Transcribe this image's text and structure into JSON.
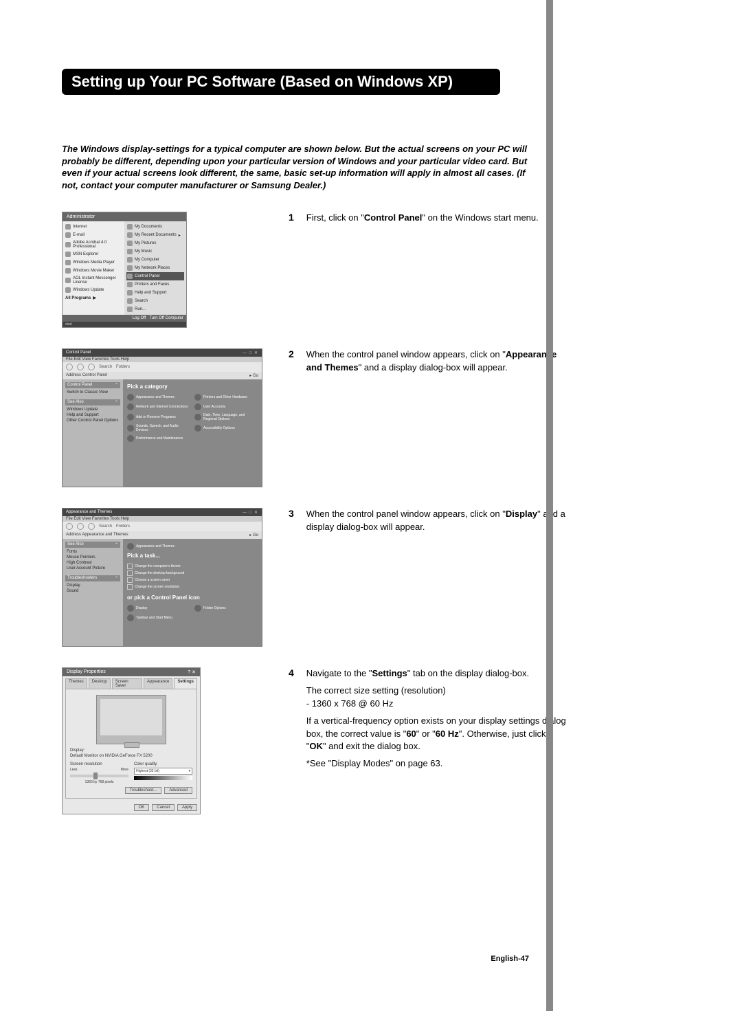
{
  "page_title": "Setting up Your PC Software (Based on Windows XP)",
  "intro_text": "The Windows display-settings for a typical computer are shown below. But the actual screens on your PC will probably be different, depending upon your particular version of Windows and your particular video card. But even if your actual screens look different, the same, basic set-up information will apply in almost all cases. (If not, contact your computer manufacturer or Samsung Dealer.)",
  "page_number": "English-47",
  "steps": [
    {
      "num": "1",
      "lines": [
        "First, click on \"<b>Control Panel</b>\" on the Windows start menu."
      ]
    },
    {
      "num": "2",
      "lines": [
        "When the control panel window appears, click on \"<b>Appearance and Themes</b>\" and a display dialog-box will appear."
      ]
    },
    {
      "num": "3",
      "lines": [
        "When the control panel window appears, click on \"<b>Display</b>\" and a display dialog-box will appear."
      ]
    },
    {
      "num": "4",
      "lines": [
        "Navigate to the \"<b>Settings</b>\" tab on the display dialog-box.",
        "The correct size setting (resolution)<br>- 1360 x 768 @ 60 Hz",
        "If a vertical-frequency option exists on your display settings dialog box, the correct value is \"<b>60</b>\" or \"<b>60 Hz</b>\". Otherwise, just click \"<b>OK</b>\" and exit the dialog box.",
        "*See \"Display Modes\" on page 63."
      ]
    }
  ],
  "fig1": {
    "user": "Administrator",
    "left": [
      "Internet",
      "E-mail",
      "Adobe Acrobat 4.0 Professional",
      "MSN Explorer",
      "Windows Media Player",
      "Windows Movie Maker",
      "AOL Instant Messenger License",
      "Windows Update",
      "All Programs"
    ],
    "right_top": [
      "My Documents",
      "My Recent Documents",
      "My Pictures",
      "My Music",
      "My Computer",
      "My Network Places"
    ],
    "right_sel": "Control Panel",
    "right_bottom": [
      "Printers and Faxes",
      "Help and Support",
      "Search",
      "Run..."
    ],
    "logoff": "Log Off",
    "turnoff": "Turn Off Computer",
    "start": "start"
  },
  "fig2": {
    "title": "Control Panel",
    "menu": "File  Edit  View  Favorites  Tools  Help",
    "tb_search": "Search",
    "tb_folders": "Folders",
    "addr_label": "Address",
    "addr_value": "Control Panel",
    "go": "Go",
    "side": {
      "h1": "Control Panel",
      "i1": "Switch to Classic View",
      "h2": "See Also",
      "i2": [
        "Windows Update",
        "Help and Support",
        "Other Control Panel Options"
      ]
    },
    "cat_title": "Pick a category",
    "cats": [
      "Appearance and Themes",
      "Printers and Other Hardware",
      "Network and Internet Connections",
      "User Accounts",
      "Add or Remove Programs",
      "Date, Time, Language, and Regional Options",
      "Sounds, Speech, and Audio Devices",
      "Accessibility Options",
      "Performance and Maintenance"
    ]
  },
  "fig3": {
    "title": "Appearance and Themes",
    "menu": "File  Edit  View  Favorites  Tools  Help",
    "addr_value": "Appearance and Themes",
    "side": {
      "h1": "See Also",
      "i1": [
        "Fonts",
        "Mouse Pointers",
        "High Contrast",
        "User Account Picture"
      ],
      "h2": "Troubleshooters",
      "i2": [
        "Display",
        "Sound"
      ]
    },
    "section1": "Appearance and Themes",
    "task_title": "Pick a task...",
    "tasks": [
      "Change the computer's theme",
      "Change the desktop background",
      "Choose a screen saver",
      "Change the screen resolution"
    ],
    "or_title": "or pick a Control Panel icon",
    "icons": [
      "Display",
      "Folder Options",
      "Taskbar and Start Menu"
    ]
  },
  "fig4": {
    "title": "Display Properties",
    "tabs": [
      "Themes",
      "Desktop",
      "Screen Saver",
      "Appearance",
      "Settings"
    ],
    "selected_tab": 4,
    "display_label": "Display:",
    "display_text": "Default Monitor on NVIDIA GeForce FX 5200",
    "res_label": "Screen resolution",
    "res_less": "Less",
    "res_more": "More",
    "res_value": "1360 by 768 pixels",
    "cq_label": "Color quality",
    "cq_value": "Highest (32 bit)",
    "btn_ts": "Troubleshoot...",
    "btn_adv": "Advanced",
    "btn_ok": "OK",
    "btn_cancel": "Cancel",
    "btn_apply": "Apply"
  }
}
